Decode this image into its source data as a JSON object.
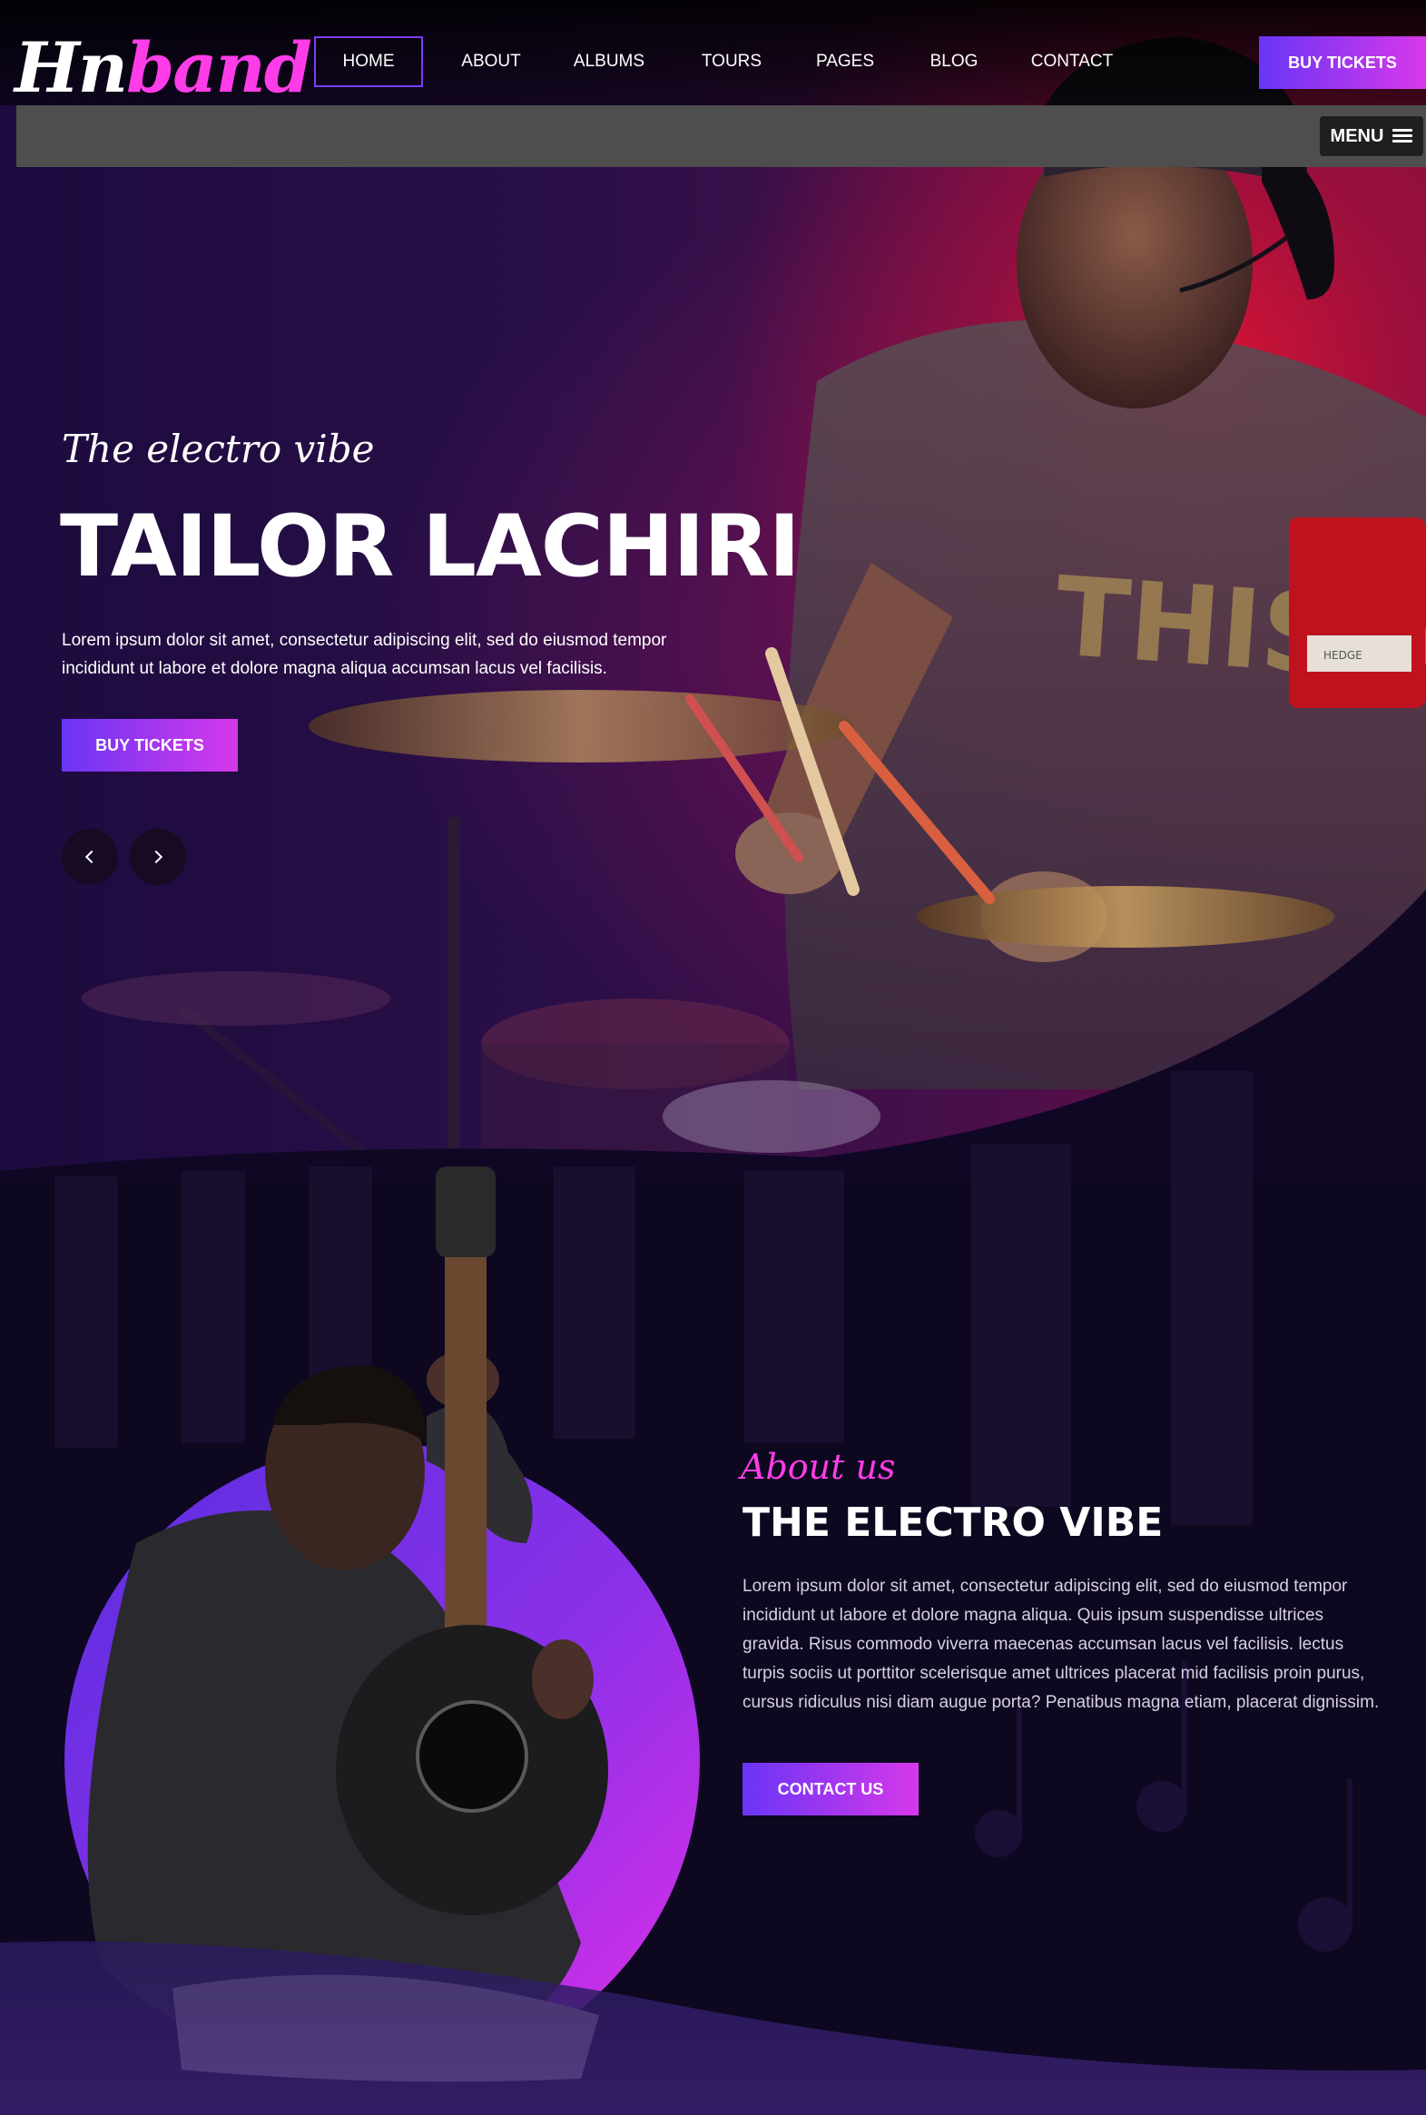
{
  "header": {
    "logo_part1": "Hn",
    "logo_part2": "band",
    "nav": [
      "HOME",
      "ABOUT",
      "ALBUMS",
      "TOURS",
      "PAGES",
      "BLOG",
      "CONTACT"
    ],
    "tickets_label": "BUY TICKETS",
    "menu_label": "MENU"
  },
  "hero": {
    "tagline": "The electro vibe",
    "title": "TAILOR LACHIRI",
    "description": "Lorem ipsum dolor sit amet, consectetur adipiscing elit, sed do eiusmod tempor incididunt ut labore et dolore magna aliqua accumsan lacus vel facilisis.",
    "button_label": "BUY TICKETS",
    "drum_label": "THIS NOISE",
    "brand_mark": "HEDGE"
  },
  "about": {
    "tagline": "About us",
    "title": "THE ELECTRO VIBE",
    "description": "Lorem ipsum dolor sit amet, consectetur adipiscing elit, sed do eiusmod tempor incididunt ut labore et dolore magna aliqua. Quis ipsum suspendisse ultrices gravida. Risus commodo viverra maecenas accumsan lacus vel facilisis. lectus turpis sociis ut porttitor scelerisque amet ultrices placerat mid facilisis proin purus, cursus ridiculus nisi diam augue porta? Penatibus magna etiam, placerat dignissim.",
    "button_label": "CONTACT US"
  },
  "colors": {
    "accent_purple": "#6a35f5",
    "accent_pink": "#d738ea",
    "tagline_pink": "#ff3de8",
    "background_dark": "#0d0720"
  },
  "icons": {
    "prev": "chevron-left-icon",
    "next": "chevron-right-icon",
    "menu": "hamburger-icon"
  }
}
